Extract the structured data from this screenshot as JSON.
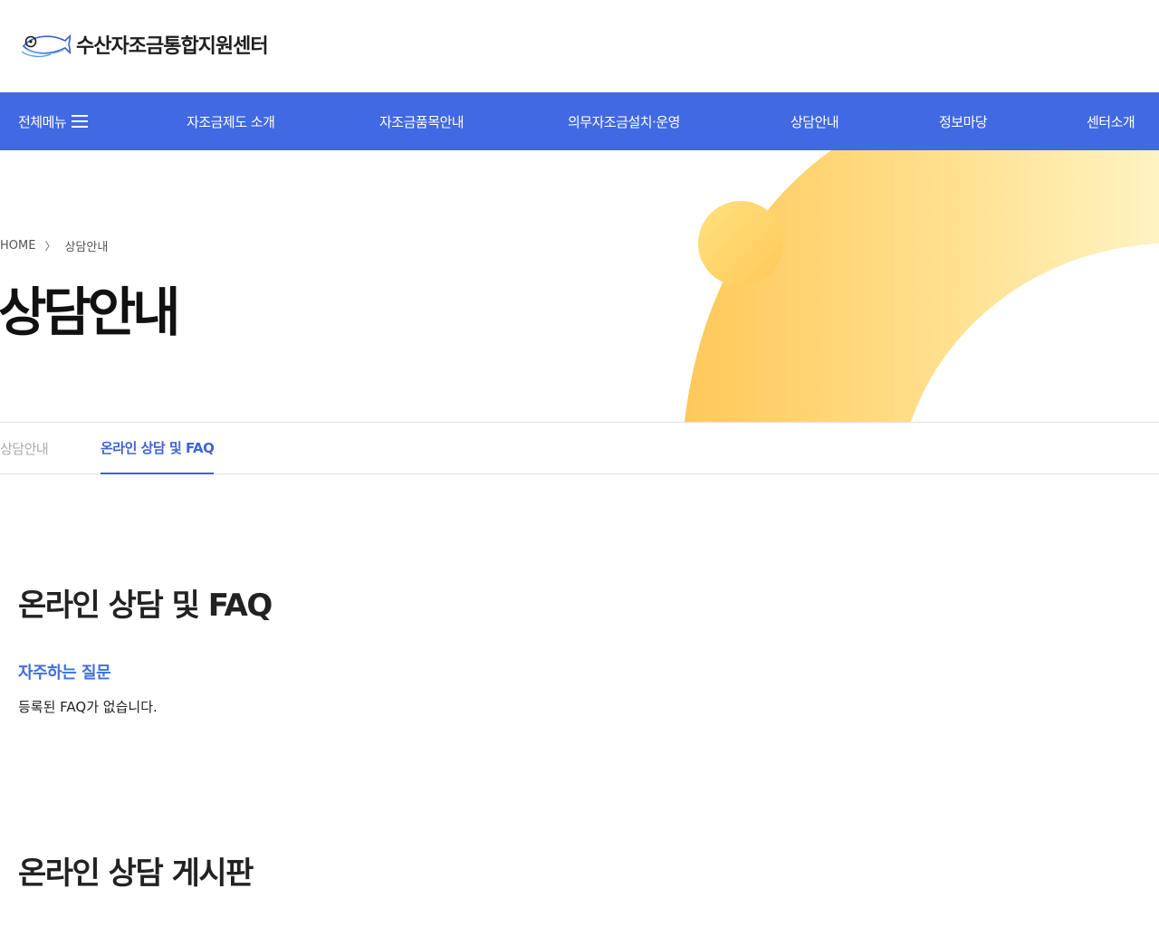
{
  "header": {
    "logo_text": "수산자조금통합지원센터",
    "logo_icon": "fish-icon"
  },
  "gnb": {
    "all_menu_label": "전체메뉴",
    "menu_icon": "hamburger-icon",
    "items": [
      "자조금제도 소개",
      "자조금품목안내",
      "의무자조금설치·운영",
      "상담안내",
      "정보마당",
      "센터소개"
    ]
  },
  "hero": {
    "breadcrumb": {
      "home": "HOME",
      "separator": "〉",
      "current": "상담안내"
    },
    "title": "상담안내"
  },
  "subtabs": [
    {
      "label": "상담안내",
      "active": false
    },
    {
      "label": "온라인 상담 및 FAQ",
      "active": true
    }
  ],
  "content": {
    "section1_title": "온라인 상담 및 FAQ",
    "faq_heading": "자주하는 질문",
    "faq_empty": "등록된 FAQ가 없습니다.",
    "section2_title": "온라인 상담 게시판"
  },
  "colors": {
    "nav_bg": "#4169e1",
    "accent": "#3e63d8",
    "hero_gradient_start": "#ffc85a",
    "hero_gradient_end": "#fff3c2"
  }
}
